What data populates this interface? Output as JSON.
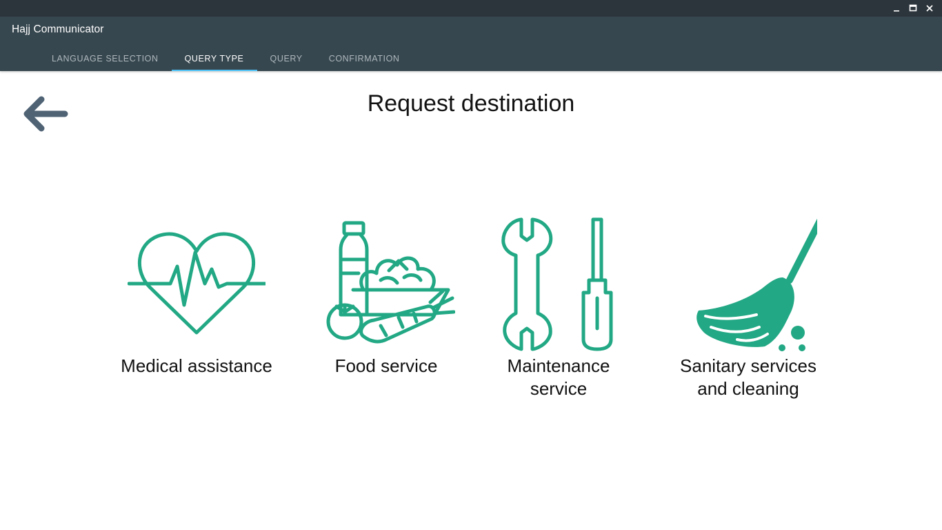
{
  "window": {
    "title": "Hajj Communicator",
    "controls": [
      "minimize-icon",
      "maximize-icon",
      "close-icon"
    ]
  },
  "tabs": [
    {
      "label": "LANGUAGE SELECTION",
      "active": false
    },
    {
      "label": "QUERY TYPE",
      "active": true
    },
    {
      "label": "QUERY",
      "active": false
    },
    {
      "label": "CONFIRMATION",
      "active": false
    }
  ],
  "page": {
    "title": "Request destination",
    "back_icon": "arrow-left-icon"
  },
  "options": [
    {
      "label": "Medical assistance",
      "icon": "heart-pulse-icon"
    },
    {
      "label": "Food service",
      "icon": "food-basket-icon"
    },
    {
      "label": "Maintenance service",
      "icon": "wrench-screwdriver-icon"
    },
    {
      "label": "Sanitary services and cleaning",
      "icon": "broom-icon"
    }
  ],
  "colors": {
    "titlebar": "#2c353c",
    "appbar": "#37474f",
    "tab_indicator": "#4fc3f7",
    "icon_accent": "#22a884",
    "back_arrow": "#4f6375"
  }
}
